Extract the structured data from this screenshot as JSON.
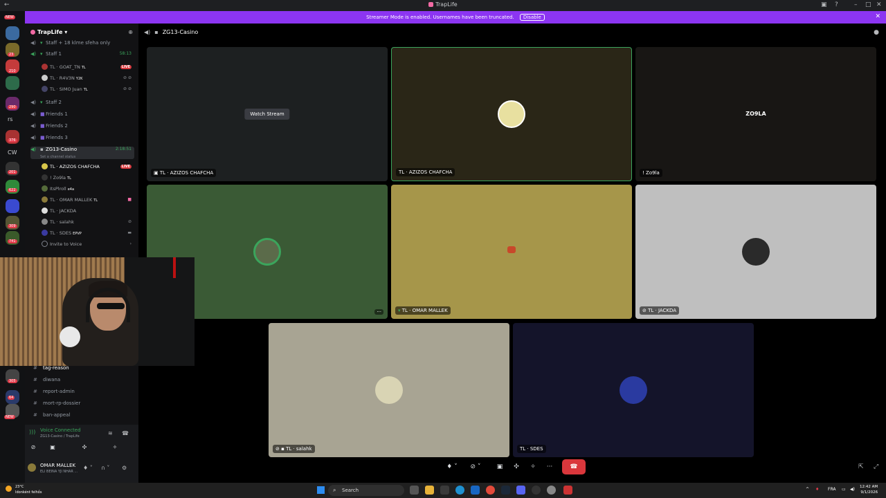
{
  "window": {
    "title": "TrapLife"
  },
  "banner": {
    "text": "Streamer Mode is enabled. Usernames have been truncated.",
    "disable_label": "Disable"
  },
  "rail": {
    "badges": [
      "NEW",
      "23",
      "210",
      "290",
      "376",
      "201",
      "622",
      "309",
      "741",
      "305",
      "64"
    ],
    "letters": [
      "rs",
      "CW"
    ],
    "new_bottom": "NEW"
  },
  "sidebar": {
    "server_name": "TrapLife",
    "channels": [
      {
        "name": "Staff + 18 klme sfeha only"
      },
      {
        "name": "Staff 1",
        "timer": "58:13"
      },
      {
        "name": "Staff 2"
      },
      {
        "name": "Friends 1"
      },
      {
        "name": "Friends 2"
      },
      {
        "name": "Friends 3"
      }
    ],
    "staff1_users": [
      {
        "name": "TL · GOAT_TN",
        "tag": "TL",
        "live": "LIVE"
      },
      {
        "name": "TL · R4V3N",
        "tag": "Y2K"
      },
      {
        "name": "TL · SIMO Juan",
        "tag": "TL"
      }
    ],
    "active_channel": {
      "name": "ZG13-Casino",
      "timer": "2:18:51",
      "status_hint": "Set a channel status"
    },
    "casino_users": [
      {
        "name": "TL · AZIZOS CHAFCHA",
        "live": "LIVE"
      },
      {
        "name": "! Zo9la",
        "tag": "TL"
      },
      {
        "name": "ItsPlroll",
        "tag": "e4a"
      },
      {
        "name": "TL · OMAR MALLEK",
        "tag": "TL"
      },
      {
        "name": "TL · JACKDA"
      },
      {
        "name": "TL · salahk"
      },
      {
        "name": "TL · SDES",
        "tag": "EPVP"
      }
    ],
    "invite_label": "Invite to Voice",
    "text_channels": [
      "tag-reason",
      "diwana",
      "report-admin",
      "mort-rp-dossier",
      "ban-appeal"
    ]
  },
  "voice": {
    "state": "Voice Connected",
    "location": "ZG13-Casino / TrapLife",
    "user_name": "OMAR MALLEK",
    "user_status": "ELI BEINA YJI NHAR ..."
  },
  "main": {
    "channel_title": "ZG13-Casino",
    "watch_label": "Watch Stream",
    "tiles": [
      {
        "name": "TL · AZIZOS CHAFCHA",
        "bg": "#1d2021"
      },
      {
        "name": "TL · AZIZOS CHAFCHA",
        "bg": "#2a2617",
        "speaking": true
      },
      {
        "name": "! Zo9la",
        "bg": "#181614",
        "avatar_text": "ZO9LA"
      },
      {
        "name": "",
        "bg": "#3a5a35"
      },
      {
        "name": "TL · OMAR MALLEK",
        "bg": "#a6964a"
      },
      {
        "name": "TL · JACKDA",
        "bg": "#bfbfbf"
      },
      {
        "name": "TL · salahk",
        "bg": "#a8a493"
      },
      {
        "name": "TL · SDES",
        "bg": "#14142a"
      }
    ]
  },
  "taskbar": {
    "weather_temp": "23°C",
    "weather_desc": "Idonként felhős",
    "search_label": "Search",
    "lang": "FRA",
    "time": "12:42 AM",
    "date": "9/1/2026"
  },
  "colors": {
    "accent": "#8c35f2",
    "live": "#da373c",
    "online": "#3ba55c"
  }
}
